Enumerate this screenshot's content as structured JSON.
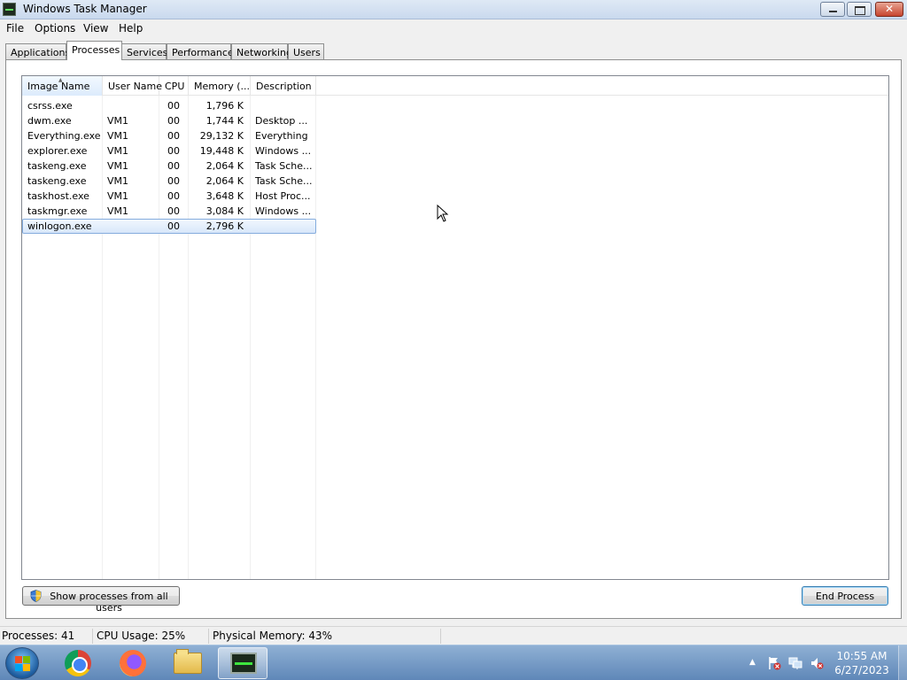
{
  "window": {
    "title": "Windows Task Manager"
  },
  "menu": [
    "File",
    "Options",
    "View",
    "Help"
  ],
  "tabs": [
    {
      "label": "Applications",
      "active": false
    },
    {
      "label": "Processes",
      "active": true
    },
    {
      "label": "Services",
      "active": false
    },
    {
      "label": "Performance",
      "active": false
    },
    {
      "label": "Networking",
      "active": false
    },
    {
      "label": "Users",
      "active": false
    }
  ],
  "table": {
    "sorted_column": "Image Name",
    "columns": [
      "Image Name",
      "User Name",
      "CPU",
      "Memory (...",
      "Description"
    ],
    "rows": [
      {
        "name": "csrss.exe",
        "user": "",
        "cpu": "00",
        "memory": "1,796 K",
        "description": ""
      },
      {
        "name": "dwm.exe",
        "user": "VM1",
        "cpu": "00",
        "memory": "1,744 K",
        "description": "Desktop ..."
      },
      {
        "name": "Everything.exe",
        "user": "VM1",
        "cpu": "00",
        "memory": "29,132 K",
        "description": "Everything"
      },
      {
        "name": "explorer.exe",
        "user": "VM1",
        "cpu": "00",
        "memory": "19,448 K",
        "description": "Windows ..."
      },
      {
        "name": "taskeng.exe",
        "user": "VM1",
        "cpu": "00",
        "memory": "2,064 K",
        "description": "Task Sche..."
      },
      {
        "name": "taskeng.exe",
        "user": "VM1",
        "cpu": "00",
        "memory": "2,064 K",
        "description": "Task Sche..."
      },
      {
        "name": "taskhost.exe",
        "user": "VM1",
        "cpu": "00",
        "memory": "3,648 K",
        "description": "Host Proc..."
      },
      {
        "name": "taskmgr.exe",
        "user": "VM1",
        "cpu": "00",
        "memory": "3,084 K",
        "description": "Windows ..."
      },
      {
        "name": "winlogon.exe",
        "user": "",
        "cpu": "00",
        "memory": "2,796 K",
        "description": "",
        "selected": true
      }
    ]
  },
  "buttons": {
    "show_all": "Show processes from all users",
    "end_process": "End Process"
  },
  "status": {
    "processes": "Processes: 41",
    "cpu": "CPU Usage: 25%",
    "memory": "Physical Memory: 43%"
  },
  "taskbar": {
    "items": [
      "start-button",
      "chrome-icon",
      "firefox-icon",
      "file-explorer-icon",
      "task-manager-icon"
    ],
    "active_item": "task-manager-icon",
    "tray_icons": [
      "show-hidden-icons-arrow",
      "action-center-icon",
      "network-icon",
      "volume-muted-icon"
    ],
    "clock_time": "10:55 AM",
    "clock_date": "6/27/2023"
  },
  "colors": {
    "selection": "#d8e7fa",
    "selection_border": "#84acdd",
    "taskbar": "#6f94c2",
    "close_button": "#c7452f"
  }
}
